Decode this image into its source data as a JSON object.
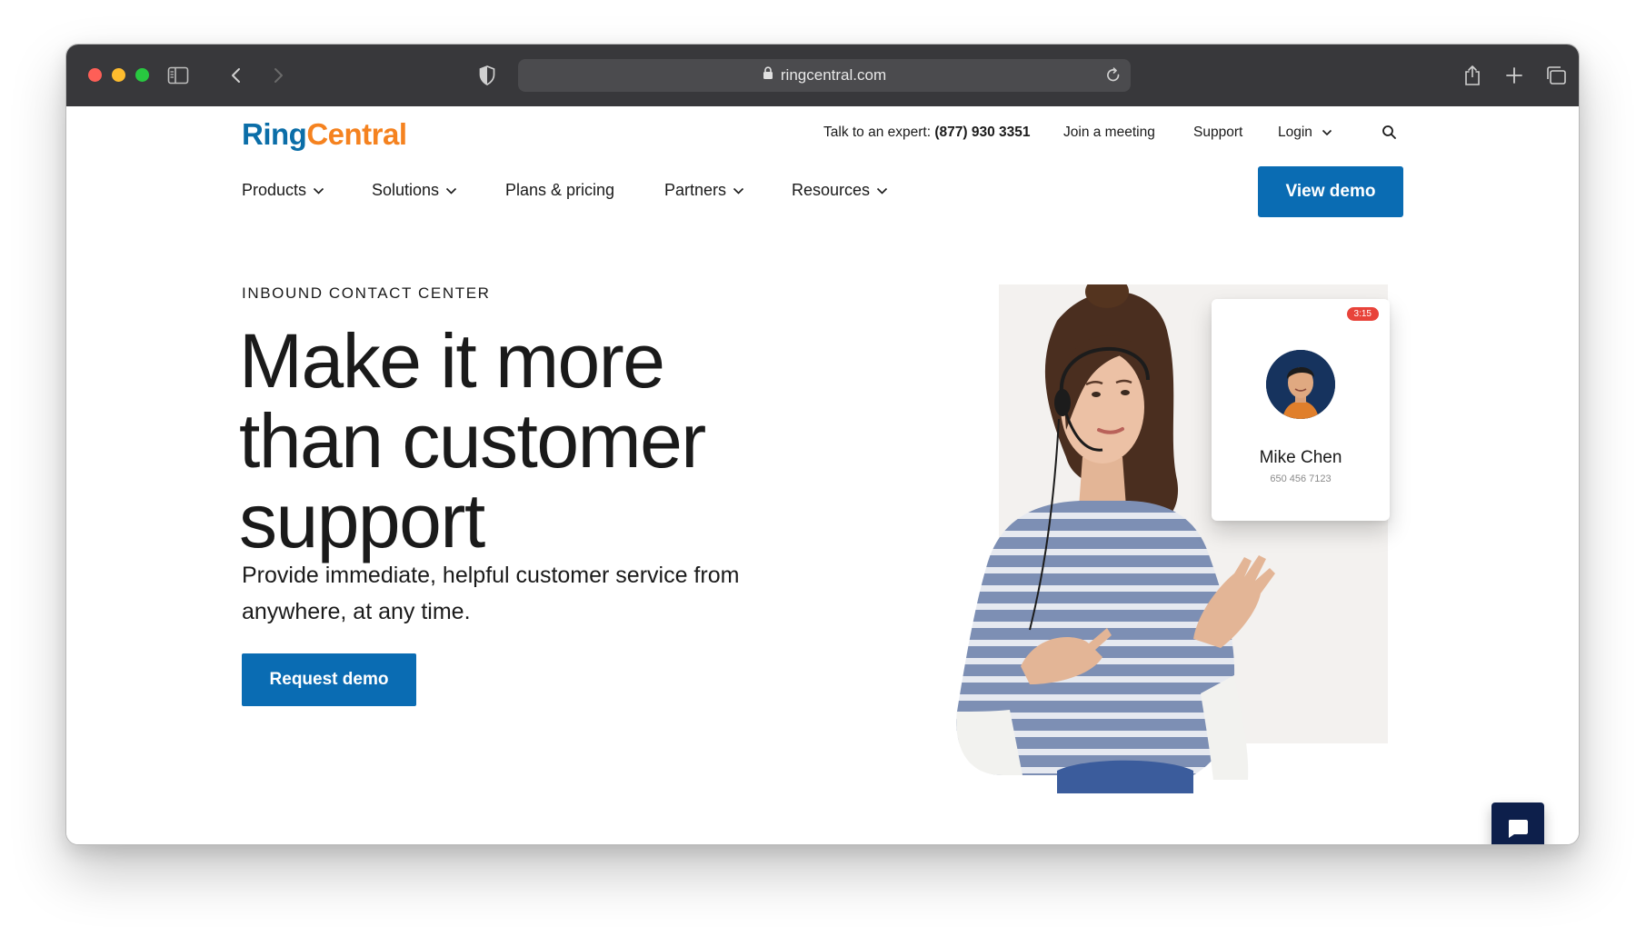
{
  "browser": {
    "url": "ringcentral.com",
    "icons": {
      "sidebar": "sidebar-icon",
      "back": "chevron-left-icon",
      "forward": "chevron-right-icon",
      "privacy": "shield-icon",
      "lock": "lock-icon",
      "reload": "reload-icon",
      "share": "share-icon",
      "new_tab": "plus-icon",
      "tabs": "tabs-overview-icon"
    }
  },
  "site": {
    "logo": {
      "part1": "Ring",
      "part2": "Central"
    },
    "utility": {
      "expert_label": "Talk to an expert:",
      "expert_phone": "(877) 930 3351",
      "join": "Join a meeting",
      "support": "Support",
      "login": "Login"
    },
    "nav": {
      "products": "Products",
      "solutions": "Solutions",
      "plans": "Plans & pricing",
      "partners": "Partners",
      "resources": "Resources"
    },
    "view_demo": "View demo"
  },
  "hero": {
    "eyebrow": "INBOUND CONTACT CENTER",
    "headline": "Make it more than customer support",
    "subhead": "Provide immediate, helpful customer service from anywhere, at any time.",
    "cta": "Request demo"
  },
  "call_card": {
    "timer": "3:15",
    "name": "Mike Chen",
    "phone": "650 456 7123"
  },
  "colors": {
    "brand_blue": "#0a6cb3",
    "logo_orange": "#f5821f",
    "chat_navy": "#0d1f4b",
    "timer_red": "#e8433a"
  }
}
